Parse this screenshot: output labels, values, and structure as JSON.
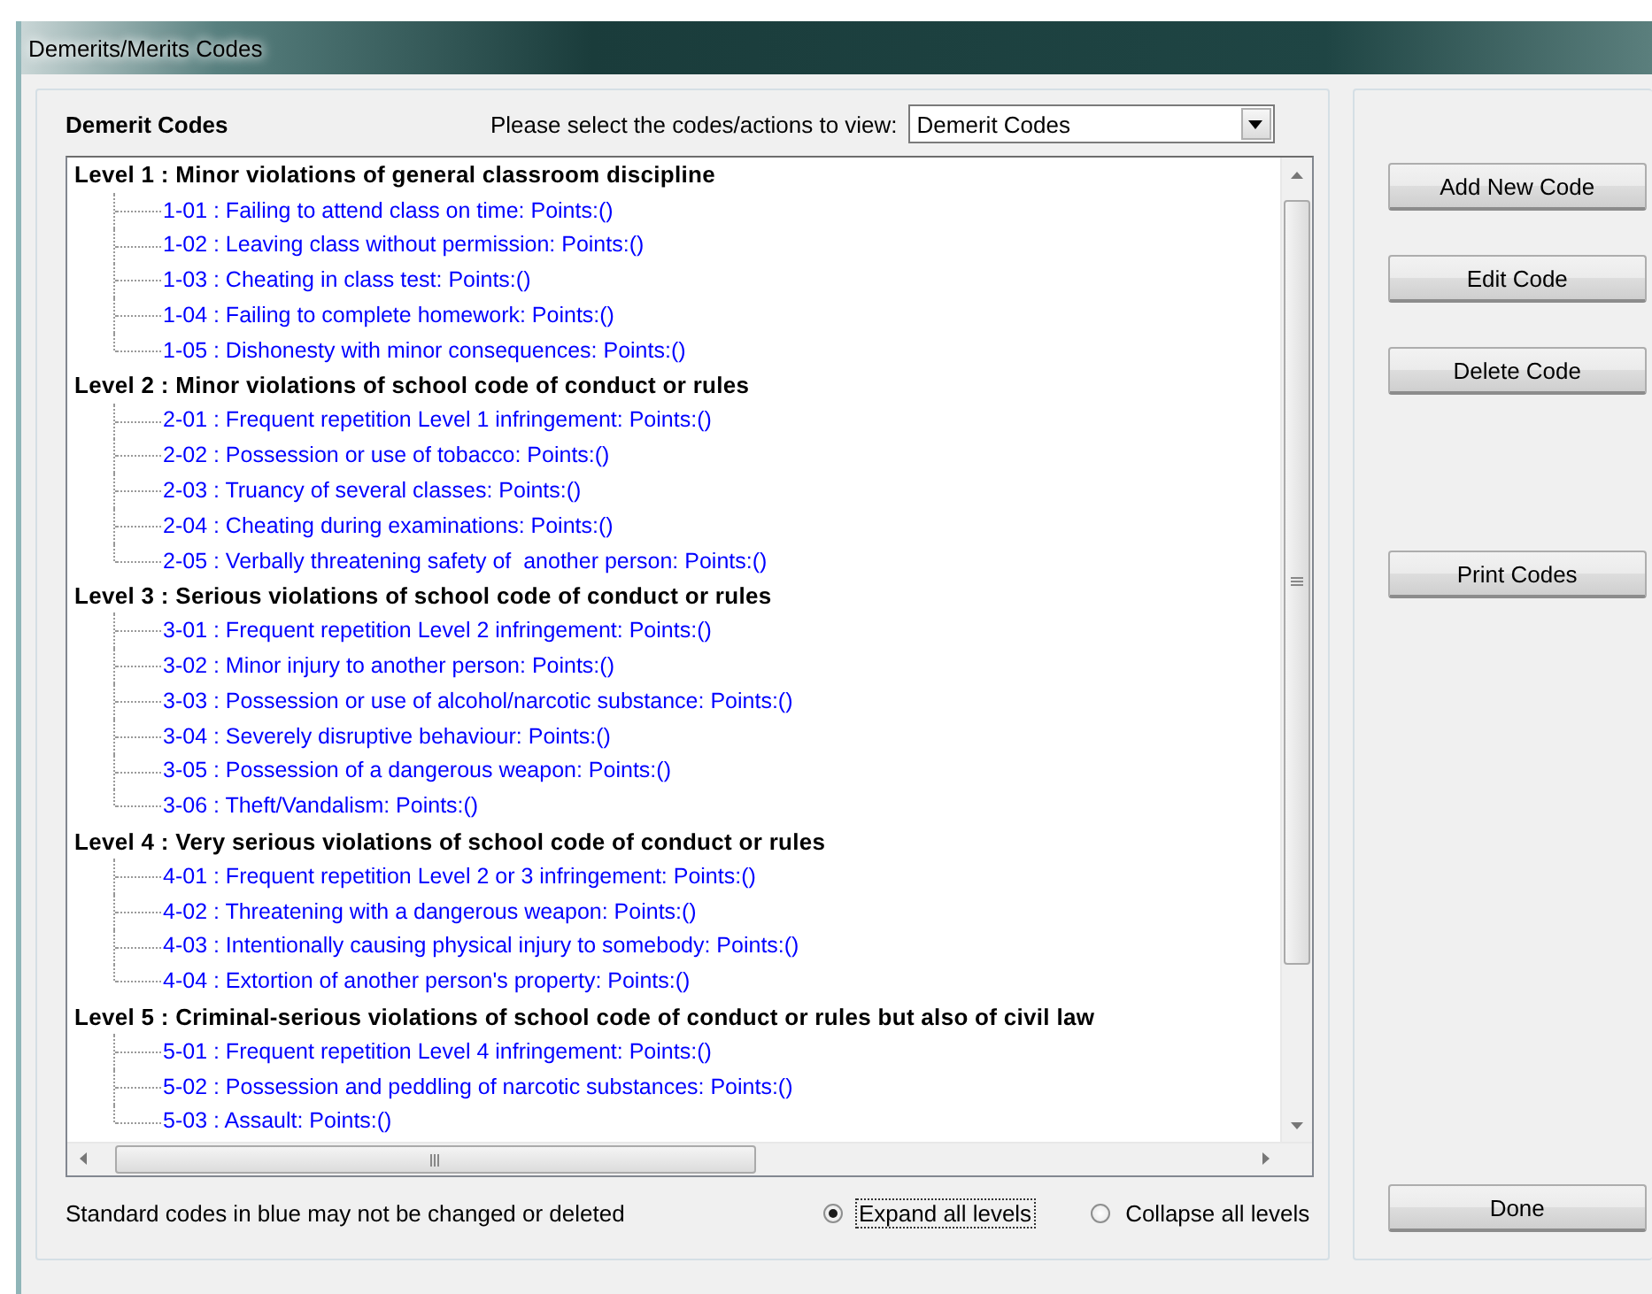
{
  "window": {
    "title": "Demerits/Merits Codes"
  },
  "header": {
    "title": "Demerit Codes",
    "prompt": "Please select the codes/actions to view:",
    "view": {
      "value": "Demerit Codes"
    }
  },
  "tree": {
    "levels": [
      {
        "label": "Level 1 : Minor violations of general classroom discipline",
        "children": [
          {
            "label": "1-01 : Failing to attend class on time: Points:()",
            "standard": true
          },
          {
            "label": "1-02 : Leaving class without permission: Points:()",
            "standard": true
          },
          {
            "label": "1-03 : Cheating in class test: Points:()",
            "standard": true
          },
          {
            "label": "1-04 : Failing to complete homework: Points:()",
            "standard": true
          },
          {
            "label": "1-05 : Dishonesty with minor consequences: Points:()",
            "standard": true
          }
        ]
      },
      {
        "label": "Level 2 : Minor violations of school code of conduct or rules",
        "children": [
          {
            "label": "2-01 : Frequent repetition Level 1 infringement: Points:()",
            "standard": true
          },
          {
            "label": "2-02 : Possession or use of tobacco: Points:()",
            "standard": true
          },
          {
            "label": "2-03 : Truancy of several classes: Points:()",
            "standard": true
          },
          {
            "label": "2-04 : Cheating during examinations: Points:()",
            "standard": true
          },
          {
            "label": "2-05 : Verbally threatening safety of  another person: Points:()",
            "standard": true
          }
        ]
      },
      {
        "label": "Level 3 : Serious violations of school code of conduct or rules",
        "children": [
          {
            "label": "3-01 : Frequent repetition Level 2 infringement: Points:()",
            "standard": true
          },
          {
            "label": "3-02 : Minor injury to another person: Points:()",
            "standard": true
          },
          {
            "label": "3-03 : Possession or use of alcohol/narcotic substance: Points:()",
            "standard": true
          },
          {
            "label": "3-04 : Severely disruptive behaviour: Points:()",
            "standard": true
          },
          {
            "label": "3-05 : Possession of a dangerous weapon: Points:()",
            "standard": true
          },
          {
            "label": "3-06 : Theft/Vandalism: Points:()",
            "standard": true
          }
        ]
      },
      {
        "label": "Level 4 : Very serious violations of school code of conduct or rules",
        "children": [
          {
            "label": "4-01 : Frequent repetition Level 2 or 3 infringement: Points:()",
            "standard": true
          },
          {
            "label": "4-02 : Threatening with a dangerous weapon: Points:()",
            "standard": true
          },
          {
            "label": "4-03 : Intentionally causing physical injury to somebody: Points:()",
            "standard": true
          },
          {
            "label": "4-04 : Extortion of another person's property: Points:()",
            "standard": true
          }
        ]
      },
      {
        "label": "Level 5 : Criminal-serious violations of school code of conduct or rules but also of civil law",
        "children": [
          {
            "label": "5-01 : Frequent repetition Level 4 infringement: Points:()",
            "standard": true
          },
          {
            "label": "5-02 : Possession and peddling of narcotic substances: Points:()",
            "standard": true
          },
          {
            "label": "5-03 : Assault: Points:()",
            "standard": true
          }
        ]
      }
    ]
  },
  "footer": {
    "note": "Standard codes in blue may not be changed or deleted",
    "options": [
      {
        "label": "Expand all levels",
        "selected": true
      },
      {
        "label": "Collapse all levels",
        "selected": false
      }
    ]
  },
  "buttons": [
    {
      "label": "Add New Code"
    },
    {
      "label": "Edit Code"
    },
    {
      "label": "Delete Code"
    },
    {
      "label": "Print Codes"
    },
    {
      "label": "Done"
    }
  ]
}
